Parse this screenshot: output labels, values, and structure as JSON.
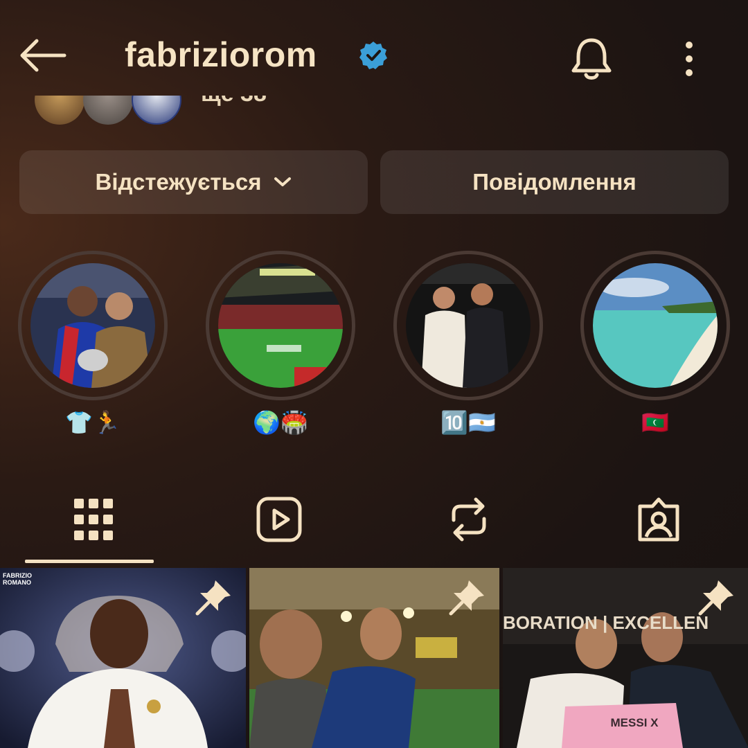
{
  "header": {
    "username": "fabriziorom",
    "icons": [
      "back-arrow-icon",
      "verified-badge-icon",
      "bell-icon",
      "more-vertical-icon"
    ]
  },
  "followed_by": {
    "text": "ще 38"
  },
  "actions": {
    "follow_label": "Відстежується",
    "message_label": "Повідомлення"
  },
  "highlights": [
    {
      "label": "👕🏃"
    },
    {
      "label": "🌍🏟️"
    },
    {
      "label": "🔟🇦🇷"
    },
    {
      "label": "🇲🇻"
    }
  ],
  "tabs": [
    "grid-icon",
    "reels-icon",
    "reposts-icon",
    "tagged-icon"
  ],
  "posts": [
    {
      "overlay_text": "FABRIZIO ROMANO",
      "pinned": true
    },
    {
      "pinned": true
    },
    {
      "banner_text": "BORATION | EXCELLEN",
      "shirt_text": "MESSI X",
      "pinned": true
    }
  ],
  "colors": {
    "text": "#f5e2c2",
    "button_bg": "rgba(255,255,255,0.09)",
    "verified": "#3b9fd8"
  }
}
